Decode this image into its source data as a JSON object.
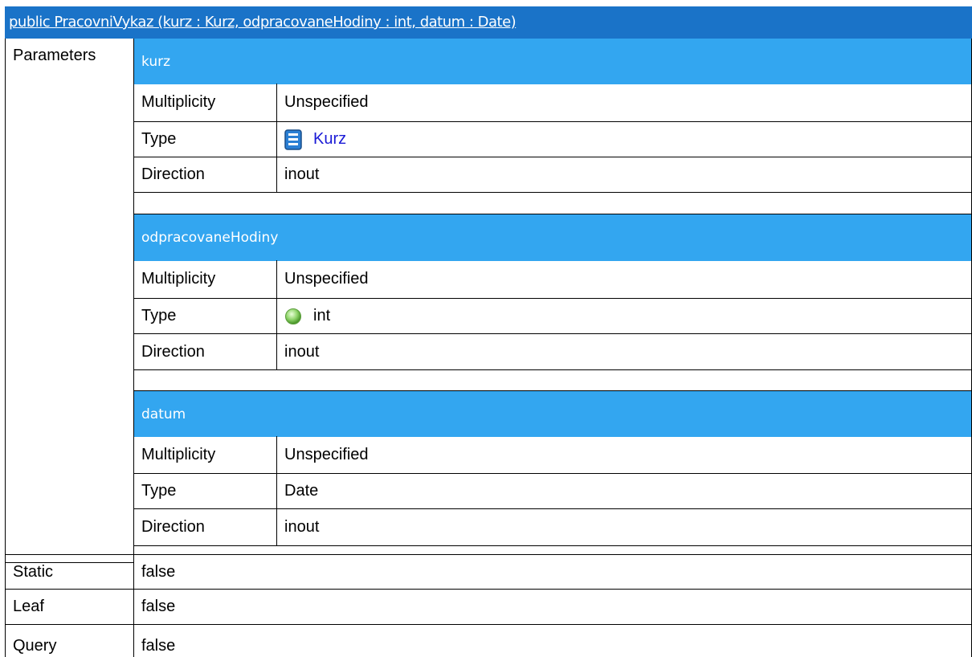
{
  "operation": {
    "signature": "public PracovniVykaz (kurz : Kurz, odpracovaneHodiny : int, datum : Date)"
  },
  "labels": {
    "parameters": "Parameters",
    "multiplicity": "Multiplicity",
    "type": "Type",
    "direction": "Direction",
    "static": "Static",
    "leaf": "Leaf",
    "query": "Query"
  },
  "parameters": [
    {
      "name": "kurz",
      "multiplicity": "Unspecified",
      "type": "Kurz",
      "type_icon": "class-icon",
      "type_is_link": true,
      "direction": "inout"
    },
    {
      "name": "odpracovaneHodiny",
      "multiplicity": "Unspecified",
      "type": "int",
      "type_icon": "primitive-type-icon",
      "type_is_link": false,
      "direction": "inout"
    },
    {
      "name": "datum",
      "multiplicity": "Unspecified",
      "type": "Date",
      "type_icon": "",
      "type_is_link": false,
      "direction": "inout"
    }
  ],
  "properties": {
    "static": "false",
    "leaf": "false",
    "query": "false"
  },
  "colors": {
    "header_bg": "#1a73c8",
    "parameter_header_bg": "#33a6f0",
    "link": "#1a1ad6"
  }
}
